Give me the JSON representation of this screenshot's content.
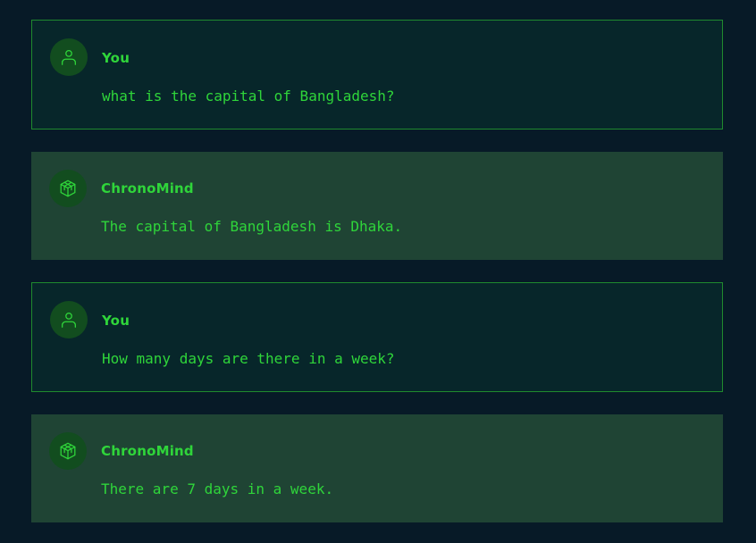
{
  "messages": [
    {
      "role": "user",
      "sender": "You",
      "text": "what is the capital of Bangladesh?",
      "avatar_icon": "user-icon"
    },
    {
      "role": "bot",
      "sender": "ChronoMind",
      "text": "The capital of Bangladesh is Dhaka.",
      "avatar_icon": "cube-icon"
    },
    {
      "role": "user",
      "sender": "You",
      "text": "How many days are there in a week?",
      "avatar_icon": "user-icon"
    },
    {
      "role": "bot",
      "sender": "ChronoMind",
      "text": "There are 7 days in a week.",
      "avatar_icon": "cube-icon"
    }
  ],
  "colors": {
    "background": "#071a27",
    "user_bubble": "#07262a",
    "user_border": "#1f8a2e",
    "bot_bubble": "#1f4434",
    "accent_text": "#2fd53a",
    "avatar_bg": "#124d1f"
  }
}
